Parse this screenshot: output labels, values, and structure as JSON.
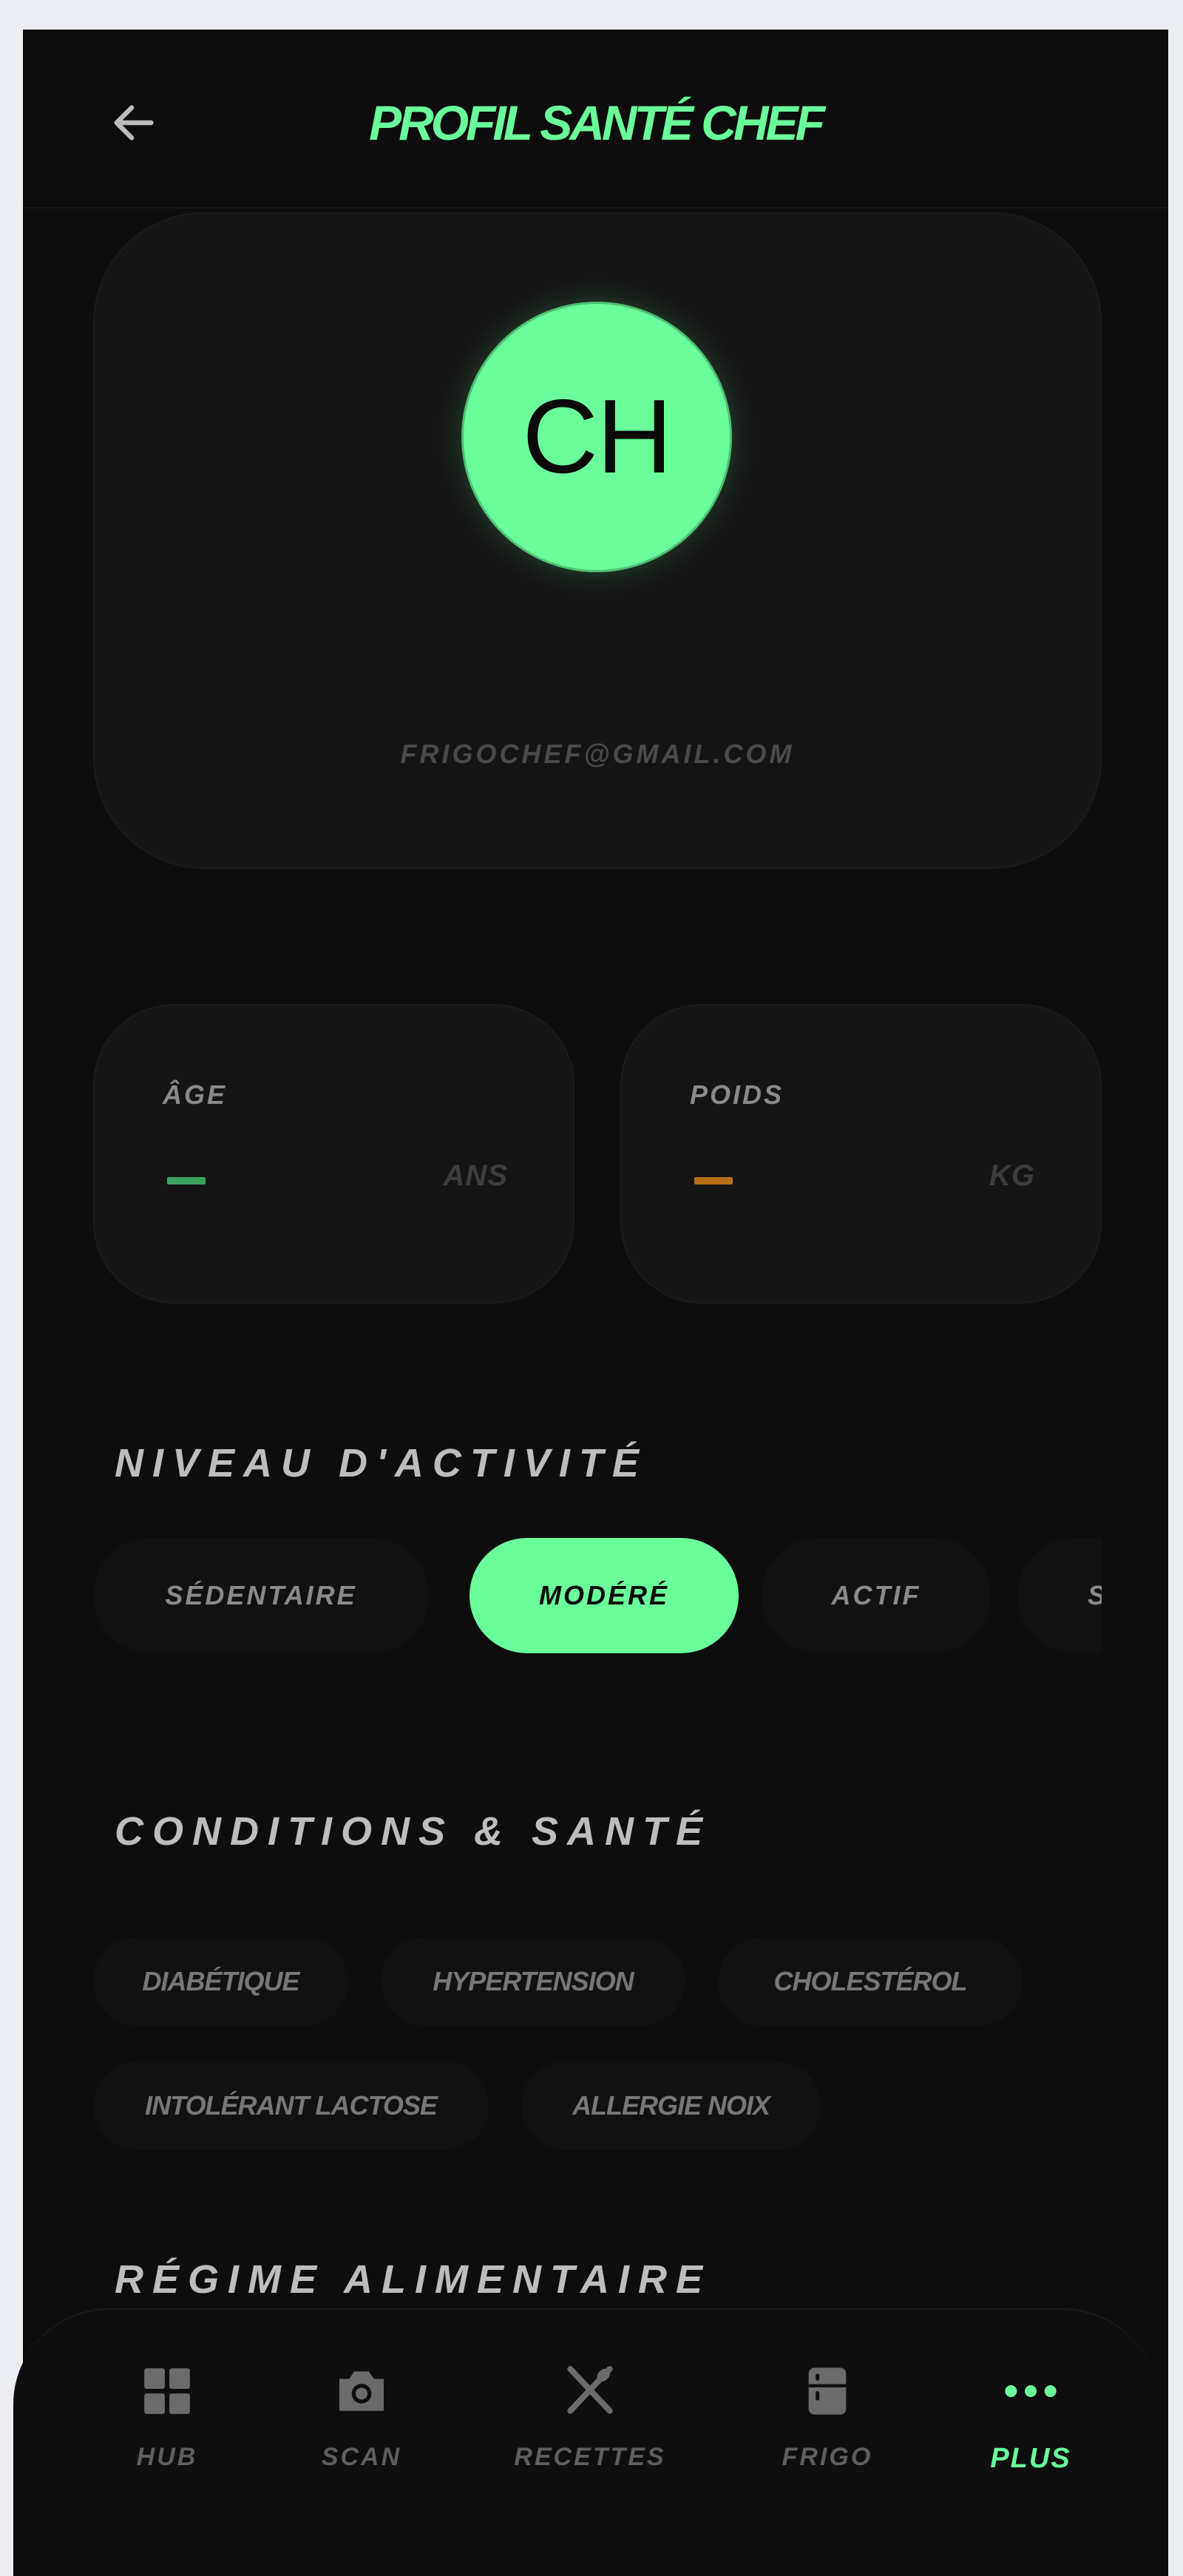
{
  "header": {
    "title": "PROFIL SANTÉ CHEF",
    "back_icon": "arrow-left-icon"
  },
  "profile": {
    "initials": "CH",
    "email": "FRIGOCHEF@GMAIL.COM"
  },
  "stats": {
    "age": {
      "label": "ÂGE",
      "value": "—",
      "unit": "ANS",
      "color": "#3ba35f"
    },
    "weight": {
      "label": "POIDS",
      "value": "—",
      "unit": "KG",
      "color": "#b56f12"
    }
  },
  "activity": {
    "title": "NIVEAU D'ACTIVITÉ",
    "options": [
      {
        "label": "SÉDENTAIRE"
      },
      {
        "label": "MODÉRÉ"
      },
      {
        "label": "ACTIF"
      },
      {
        "label": "SPORTIF"
      }
    ],
    "selected": "MODÉRÉ"
  },
  "conditions": {
    "title": "CONDITIONS & SANTÉ",
    "tags": [
      {
        "label": "DIABÉTIQUE"
      },
      {
        "label": "HYPERTENSION"
      },
      {
        "label": "CHOLESTÉROL"
      },
      {
        "label": "INTOLÉRANT LACTOSE"
      },
      {
        "label": "ALLERGIE NOIX"
      }
    ]
  },
  "diet": {
    "title": "RÉGIME ALIMENTAIRE"
  },
  "nav": {
    "items": [
      {
        "label": "HUB",
        "icon": "grid-icon"
      },
      {
        "label": "SCAN",
        "icon": "camera-icon"
      },
      {
        "label": "RECETTES",
        "icon": "utensils-icon"
      },
      {
        "label": "FRIGO",
        "icon": "fridge-icon"
      },
      {
        "label": "PLUS",
        "icon": "more-icon"
      }
    ],
    "active": "PLUS"
  },
  "colors": {
    "accent": "#6aff9b",
    "background": "#0d0d0d",
    "card": "#141414"
  }
}
